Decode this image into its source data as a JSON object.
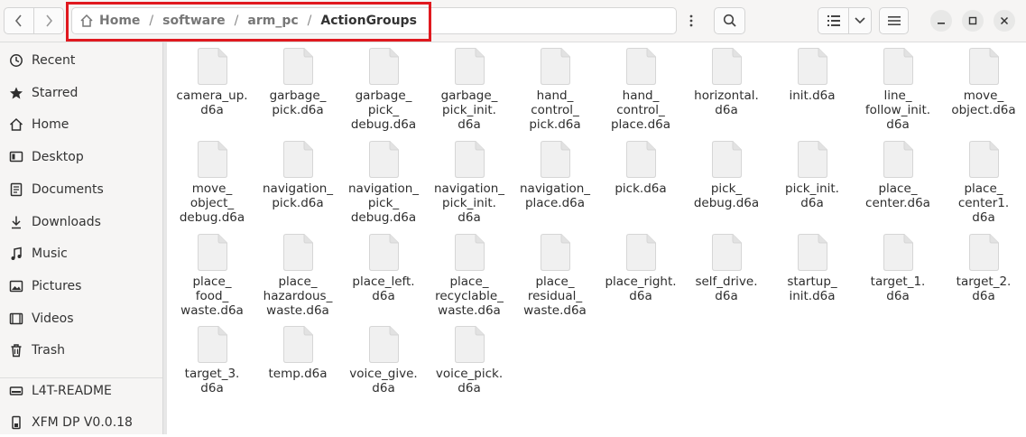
{
  "window": {
    "title": "ActionGroups"
  },
  "path": {
    "home_label": "Home",
    "crumbs": [
      "software",
      "arm_pc",
      "ActionGroups"
    ],
    "separator": "/"
  },
  "sidebar": {
    "items": [
      {
        "label": "Recent",
        "icon": "clock-icon"
      },
      {
        "label": "Starred",
        "icon": "star-icon"
      },
      {
        "label": "Home",
        "icon": "home-icon"
      },
      {
        "label": "Desktop",
        "icon": "desktop-icon"
      },
      {
        "label": "Documents",
        "icon": "document-icon"
      },
      {
        "label": "Downloads",
        "icon": "download-icon"
      },
      {
        "label": "Music",
        "icon": "music-icon"
      },
      {
        "label": "Pictures",
        "icon": "picture-icon"
      },
      {
        "label": "Videos",
        "icon": "video-icon"
      },
      {
        "label": "Trash",
        "icon": "trash-icon"
      }
    ],
    "devices": [
      {
        "label": "L4T-README",
        "icon": "drive-icon"
      },
      {
        "label": "XFM DP V0.0.18",
        "icon": "usb-drive-icon"
      }
    ]
  },
  "files": [
    "camera_up.\nd6a",
    "garbage_\npick.d6a",
    "garbage_\npick_\ndebug.d6a",
    "garbage_\npick_init.\nd6a",
    "hand_\ncontrol_\npick.d6a",
    "hand_\ncontrol_\nplace.d6a",
    "horizontal.\nd6a",
    "init.d6a",
    "line_\nfollow_init.\nd6a",
    "move_\nobject.d6a",
    "move_\nobject_\ndebug.d6a",
    "navigation_\npick.d6a",
    "navigation_\npick_\ndebug.d6a",
    "navigation_\npick_init.\nd6a",
    "navigation_\nplace.d6a",
    "pick.d6a",
    "pick_\ndebug.d6a",
    "pick_init.\nd6a",
    "place_\ncenter.d6a",
    "place_\ncenter1.\nd6a",
    "place_\nfood_\nwaste.d6a",
    "place_\nhazardous_\nwaste.d6a",
    "place_left.\nd6a",
    "place_\nrecyclable_\nwaste.d6a",
    "place_\nresidual_\nwaste.d6a",
    "place_right.\nd6a",
    "self_drive.\nd6a",
    "startup_\ninit.d6a",
    "target_1.\nd6a",
    "target_2.\nd6a",
    "target_3.\nd6a",
    "temp.d6a",
    "voice_give.\nd6a",
    "voice_pick.\nd6a"
  ]
}
